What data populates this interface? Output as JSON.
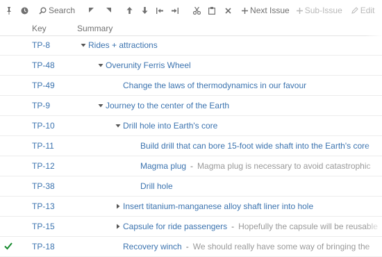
{
  "toolbar": {
    "search_label": "Search",
    "next_issue_label": "Next Issue",
    "sub_issue_label": "Sub-Issue",
    "edit_label": "Edit"
  },
  "columns": {
    "key": "Key",
    "summary": "Summary"
  },
  "rows": [
    {
      "key": "TP-8",
      "summary": "Rides + attractions",
      "description": "",
      "expander": "expanded"
    },
    {
      "key": "TP-48",
      "summary": "Overunity Ferris Wheel",
      "description": "",
      "expander": "expanded"
    },
    {
      "key": "TP-49",
      "summary": "Change the laws of thermodynamics in our favour",
      "description": "",
      "expander": "none"
    },
    {
      "key": "TP-9",
      "summary": "Journey to the center of the Earth",
      "description": "",
      "expander": "expanded"
    },
    {
      "key": "TP-10",
      "summary": "Drill hole into Earth's core",
      "description": "",
      "expander": "expanded"
    },
    {
      "key": "TP-11",
      "summary": "Build drill that can bore 15-foot wide shaft into the Earth's core",
      "description": "",
      "expander": "none"
    },
    {
      "key": "TP-12",
      "summary": "Magma plug",
      "description": "Magma plug is necessary to avoid catastrophic",
      "expander": "none"
    },
    {
      "key": "TP-38",
      "summary": "Drill hole",
      "description": "",
      "expander": "none"
    },
    {
      "key": "TP-13",
      "summary": "Insert titanium-manganese alloy shaft liner into hole",
      "description": "",
      "expander": "collapsed"
    },
    {
      "key": "TP-15",
      "summary": "Capsule for ride passengers",
      "description": "Hopefully the capsule will be reusable",
      "expander": "collapsed"
    },
    {
      "key": "TP-18",
      "summary": "Recovery winch",
      "description": "We should really have some way of bringing the",
      "expander": "none",
      "checked": true
    }
  ],
  "separator": "-",
  "colors": {
    "link": "#3b73af",
    "muted": "#707070",
    "description": "#999999",
    "check": "#14892c"
  }
}
